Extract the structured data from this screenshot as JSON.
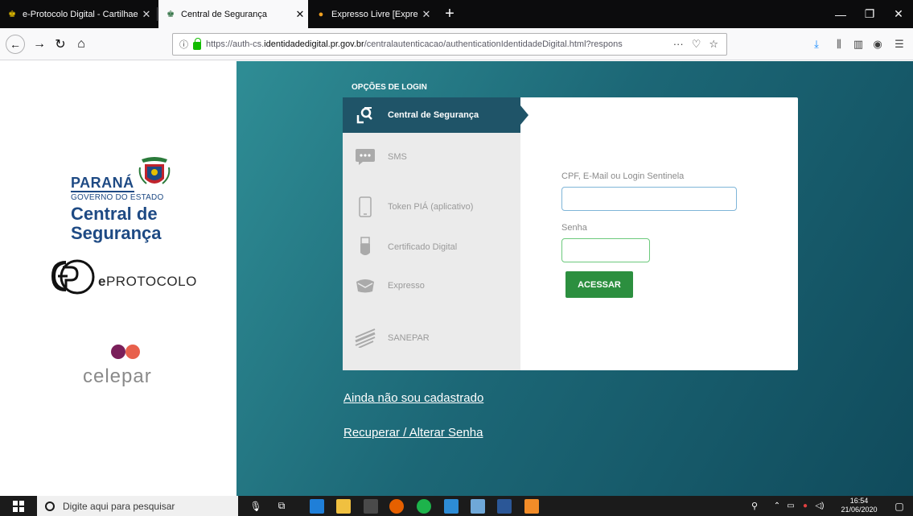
{
  "browser": {
    "tabs": [
      {
        "title": "e-Protocolo Digital - CartilhaeP",
        "active": false
      },
      {
        "title": "Central de Segurança",
        "active": true
      },
      {
        "title": "Expresso Livre [Expresso Mail]",
        "active": false
      }
    ],
    "new_tab_label": "+",
    "url_prefix": "https://auth-cs.",
    "url_domain": "identidadedigital.pr.gov.br",
    "url_path": "/centralautenticacao/authenticationIdentidadeDigital.html?respons",
    "more_icon": "···"
  },
  "branding": {
    "parana": "PARANÁ",
    "governo": "GOVERNO DO ESTADO",
    "central": "Central de",
    "seguranca": "Segurança",
    "eprotocolo_e": "e",
    "eprotocolo_rest": "PROTOCOLO",
    "celepar": "celepar"
  },
  "login": {
    "heading": "OPÇÕES DE LOGIN",
    "options": [
      {
        "label": "Central de Segurança",
        "icon": "central-seguranca-icon",
        "active": true
      },
      {
        "label": "SMS",
        "icon": "sms-icon",
        "active": false
      },
      {
        "label": "Token PIÁ (aplicativo)",
        "icon": "phone-icon",
        "active": false
      },
      {
        "label": "Certificado Digital",
        "icon": "usb-token-icon",
        "active": false
      },
      {
        "label": "Expresso",
        "icon": "mail-icon",
        "active": false
      },
      {
        "label": "SANEPAR",
        "icon": "sanepar-icon",
        "active": false
      }
    ],
    "user_label": "CPF, E-Mail ou Login Sentinela",
    "user_value": "",
    "password_label": "Senha",
    "password_value": "",
    "submit_label": "ACESSAR"
  },
  "links": {
    "register": "Ainda não sou cadastrado",
    "recover": "Recuperar / Alterar Senha"
  },
  "taskbar": {
    "search_placeholder": "Digite aqui para pesquisar",
    "time": "16:54",
    "date": "21/06/2020"
  },
  "colors": {
    "accent_dark": "#1f5468",
    "submit_green": "#2c8f3f",
    "brand_blue": "#1e4a84"
  }
}
